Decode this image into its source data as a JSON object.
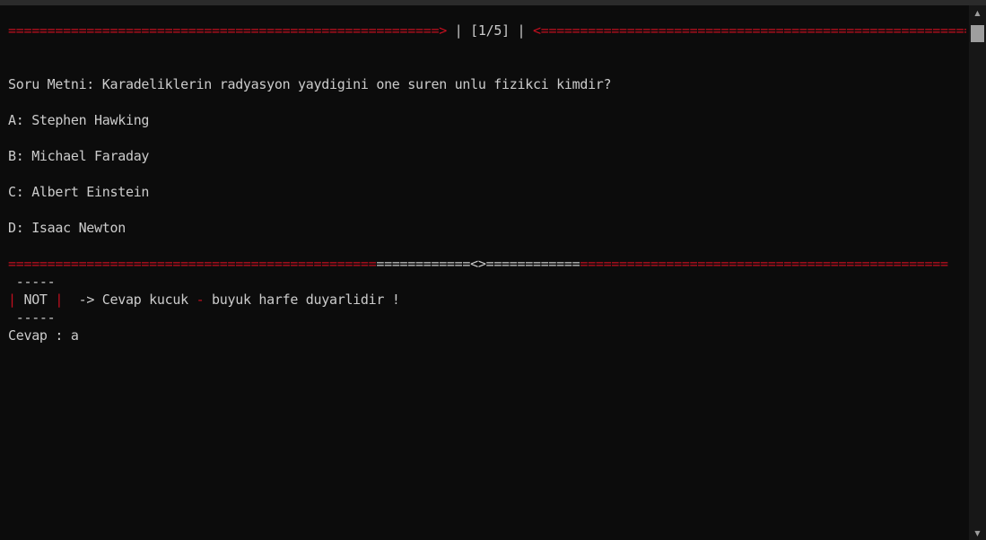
{
  "header": {
    "left_rule": "=======================================================>",
    "sep_left": " | ",
    "counter": "[1/5]",
    "sep_right": " | ",
    "right_rule": "<======================================================="
  },
  "question": {
    "text": "Soru Metni: Karadeliklerin radyasyon yaydigini one suren unlu fizikci kimdir?",
    "options": [
      "A: Stephen Hawking",
      "B: Michael Faraday",
      "C: Albert Einstein",
      "D: Isaac Newton"
    ]
  },
  "divider": {
    "left": "===============================================",
    "middle": "============<>============",
    "right": "==============================================="
  },
  "note": {
    "dashes_top": " -----",
    "bar_left": "|",
    "label": " NOT ",
    "bar_right": "|",
    "arrow_text": "  -> Cevap kucuk ",
    "hyphen": "-",
    "rest_text": " buyuk harfe duyarlidir !",
    "dashes_bottom": " -----"
  },
  "answer": {
    "prompt": "Cevap : ",
    "value": "a"
  },
  "colors": {
    "background": "#0c0c0c",
    "text": "#cccccc",
    "accent_red": "#c50f1f"
  },
  "icons": {
    "scroll_up": "▲",
    "scroll_down": "▼"
  }
}
